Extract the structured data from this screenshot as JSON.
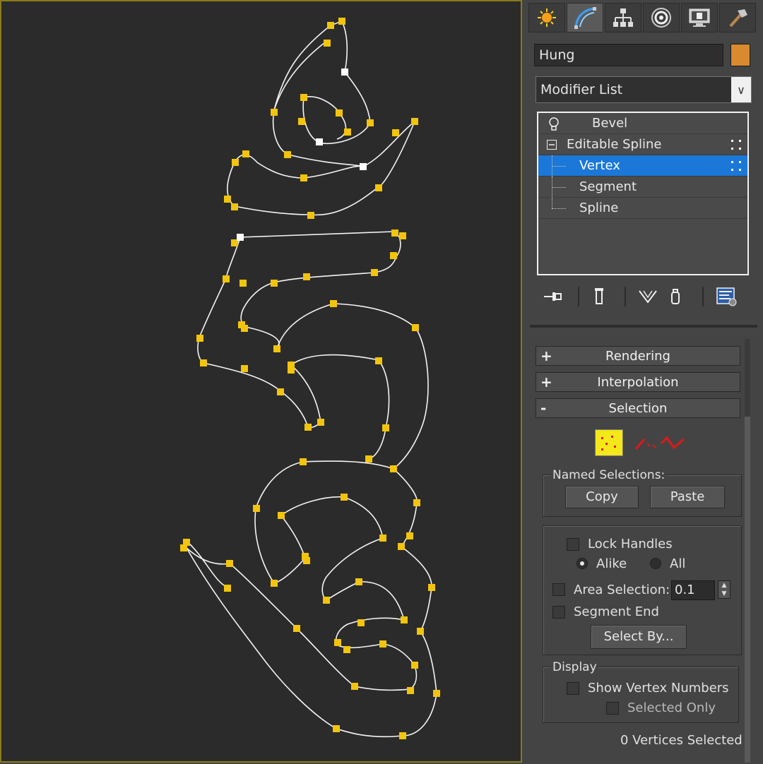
{
  "viewport": {
    "name": "Hung spline viewport"
  },
  "panel": {
    "tabs": [
      "create-icon",
      "modify-icon",
      "hierarchy-icon",
      "motion-icon",
      "display-icon",
      "utilities-icon"
    ],
    "object_name": "Hung",
    "object_color": "#d98a2e",
    "modifier_list_label": "Modifier List",
    "stack": {
      "items": [
        {
          "label": "Bevel"
        },
        {
          "label": "Editable Spline"
        },
        {
          "label": "Vertex"
        },
        {
          "label": "Segment"
        },
        {
          "label": "Spline"
        }
      ]
    },
    "rollouts": {
      "rendering": {
        "sign": "+",
        "title": "Rendering"
      },
      "interpolation": {
        "sign": "+",
        "title": "Interpolation"
      },
      "selection": {
        "sign": "-",
        "title": "Selection"
      }
    },
    "selection": {
      "named_selections_label": "Named Selections:",
      "copy_label": "Copy",
      "paste_label": "Paste",
      "lock_handles_label": "Lock Handles",
      "alike_label": "Alike",
      "all_label": "All",
      "area_selection_label": "Area Selection:",
      "area_selection_value": "0.1",
      "segment_end_label": "Segment End",
      "select_by_label": "Select By...",
      "display_label": "Display",
      "show_vertex_numbers_label": "Show Vertex Numbers",
      "selected_only_label": "Selected Only",
      "status": "0 Vertices Selected"
    },
    "colors": {
      "accent": "#1b78d8",
      "vertex": "#f2c40c"
    }
  }
}
